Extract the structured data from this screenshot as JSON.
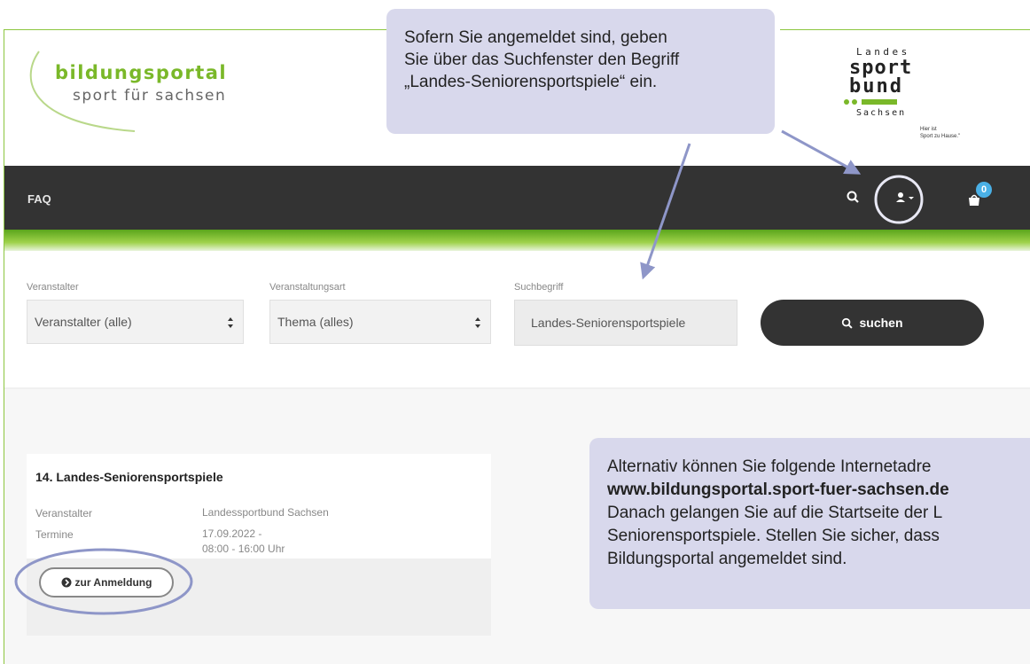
{
  "logo": {
    "line1": "bildungsportal",
    "line2": "sport für sachsen"
  },
  "lsb_logo": {
    "landes": "Landes",
    "sport": "sport",
    "bund": "bund",
    "sachsen": "Sachsen",
    "slogan_1": "Hier ist",
    "slogan_2": "Sport zu Hause.\""
  },
  "nav": {
    "faq_label": "FAQ",
    "search_icon": "search-icon",
    "user_icon": "user-icon",
    "cart_icon": "cart-icon",
    "cart_count": "0"
  },
  "filters": {
    "veranstalter_label": "Veranstalter",
    "veranstalter_value": "Veranstalter (alle)",
    "art_label": "Veranstaltungsart",
    "art_value": "Thema (alles)",
    "suchbegriff_label": "Suchbegriff",
    "suchbegriff_value": "Landes-Seniorensportspiele",
    "search_button": "suchen"
  },
  "event": {
    "title": "14. Landes-Seniorensportspiele",
    "veranstalter_key": "Veranstalter",
    "veranstalter_value": "Landessportbund Sachsen",
    "termine_key": "Termine",
    "termine_date": "17.09.2022 -",
    "termine_time": "08:00 - 16:00 Uhr",
    "register_button": "zur Anmeldung"
  },
  "callouts": {
    "top_line1": "Sofern Sie angemeldet sind, geben",
    "top_line2": "Sie über das Suchfenster den Begriff",
    "top_line3": "„Landes-Seniorensportspiele“ ein.",
    "bottom_line1": "Alternativ können Sie folgende Internetadre",
    "bottom_line2": "www.bildungsportal.sport-fuer-sachsen.de",
    "bottom_line3": "Danach gelangen Sie auf die Startseite der L",
    "bottom_line4": "Seniorensportspiele. Stellen Sie sicher, dass",
    "bottom_line5": "Bildungsportal angemeldet sind."
  },
  "colors": {
    "brand_green": "#7ab829",
    "nav_dark": "#333333",
    "callout_bg": "#d8d8ec",
    "annotation": "#8e96c8",
    "badge": "#4ab0e6"
  }
}
